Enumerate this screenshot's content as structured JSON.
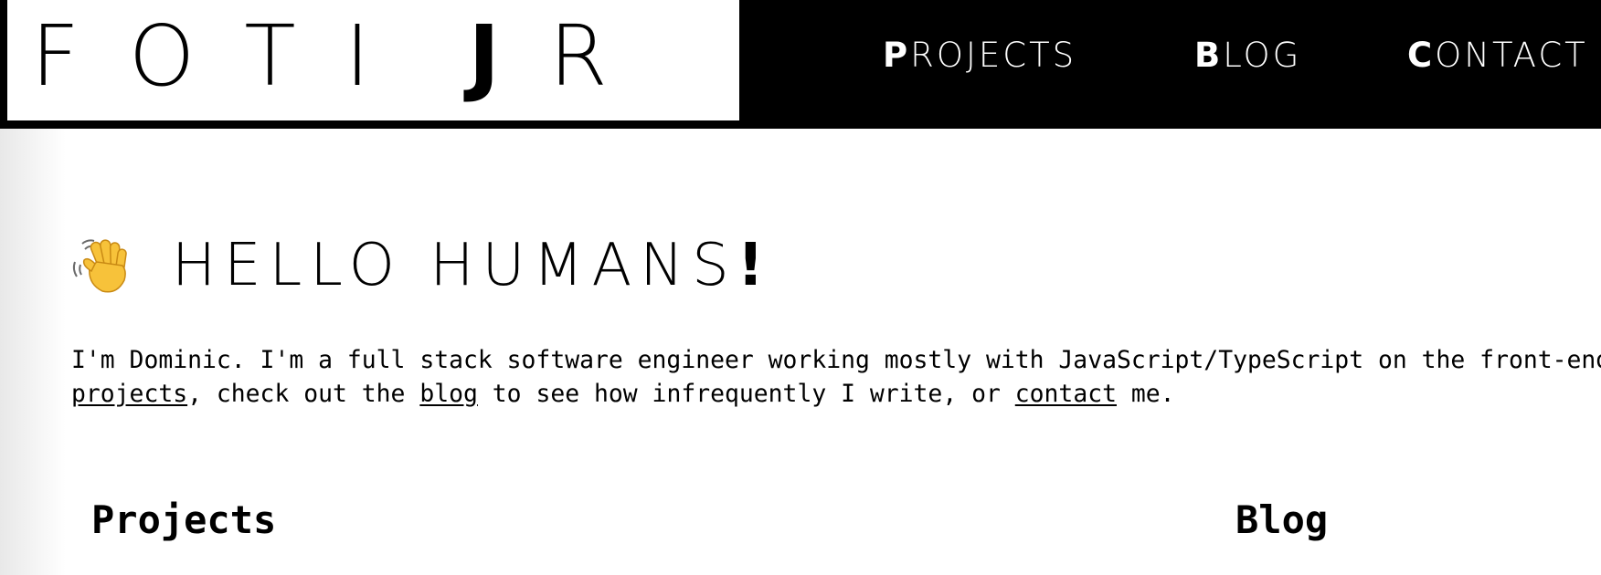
{
  "header": {
    "logo": {
      "part1": "FOTI",
      "part2_bold": "J",
      "part2_rest": "R"
    },
    "nav": [
      {
        "first": "P",
        "rest": "ROJECTS"
      },
      {
        "first": "B",
        "rest": "LOG"
      },
      {
        "first": "C",
        "rest": "ONTACT"
      }
    ]
  },
  "hero": {
    "icon": "waving-hand-icon",
    "title": "HELLO HUMANS",
    "bang": "!"
  },
  "intro": {
    "line1": "I'm Dominic. I'm a full stack software engineer working mostly with JavaScript/TypeScript on the front-end",
    "projects_link": "projects",
    "text_a": ", check out the ",
    "blog_link": "blog",
    "text_b": " to see how infrequently I write, or ",
    "contact_link": "contact",
    "text_c": " me."
  },
  "sections": {
    "projects": "Projects",
    "blog": "Blog"
  }
}
